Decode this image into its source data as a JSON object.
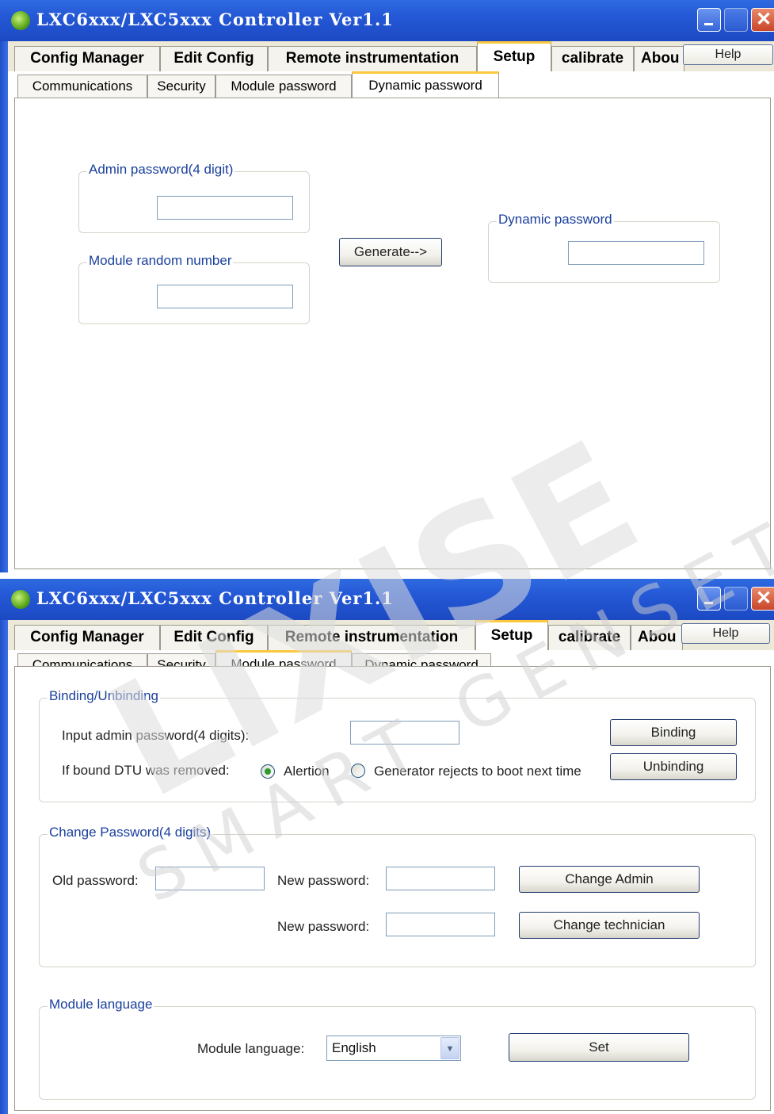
{
  "window": {
    "title": "LXC6xxx/LXC5xxx Controller Ver1.1",
    "close_glyph": "✕"
  },
  "main_tabs": [
    {
      "label": "Config Manager"
    },
    {
      "label": "Edit Config"
    },
    {
      "label": "Remote instrumentation"
    },
    {
      "label": "Setup"
    },
    {
      "label": "calibrate"
    },
    {
      "label": "Abou"
    }
  ],
  "help_label": "Help",
  "sub_tabs": [
    {
      "label": "Communications"
    },
    {
      "label": "Security"
    },
    {
      "label": "Module password"
    },
    {
      "label": "Dynamic password"
    }
  ],
  "dynamic": {
    "admin_group": "Admin password(4 digit)",
    "random_group": "Module random number",
    "generate_button": "Generate-->",
    "dynamic_group": "Dynamic password"
  },
  "module_password": {
    "binding_group": "Binding/Unbinding",
    "input_admin_label": "Input admin password(4 digits):",
    "removed_label": "If bound DTU was removed:",
    "alert_option": "Alertion",
    "reject_option": "Generator rejects to boot next time",
    "binding_button": "Binding",
    "unbinding_button": "Unbinding",
    "change_group": "Change Password(4 digits)",
    "old_password_label": "Old password:",
    "new_password_label_1": "New password:",
    "new_password_label_2": "New password:",
    "change_admin_button": "Change Admin",
    "change_technician_button": "Change technician",
    "language_group": "Module language",
    "language_label": "Module language:",
    "language_value": "English",
    "set_button": "Set"
  },
  "watermark": {
    "logo": "LIXISE",
    "tagline": "SMART GENSET"
  },
  "colors": {
    "titlebar": "#2458d6",
    "group_title": "#1a3f9c",
    "active_tab_accent": "#ffc83c",
    "watermark": "#d9d9d9"
  }
}
